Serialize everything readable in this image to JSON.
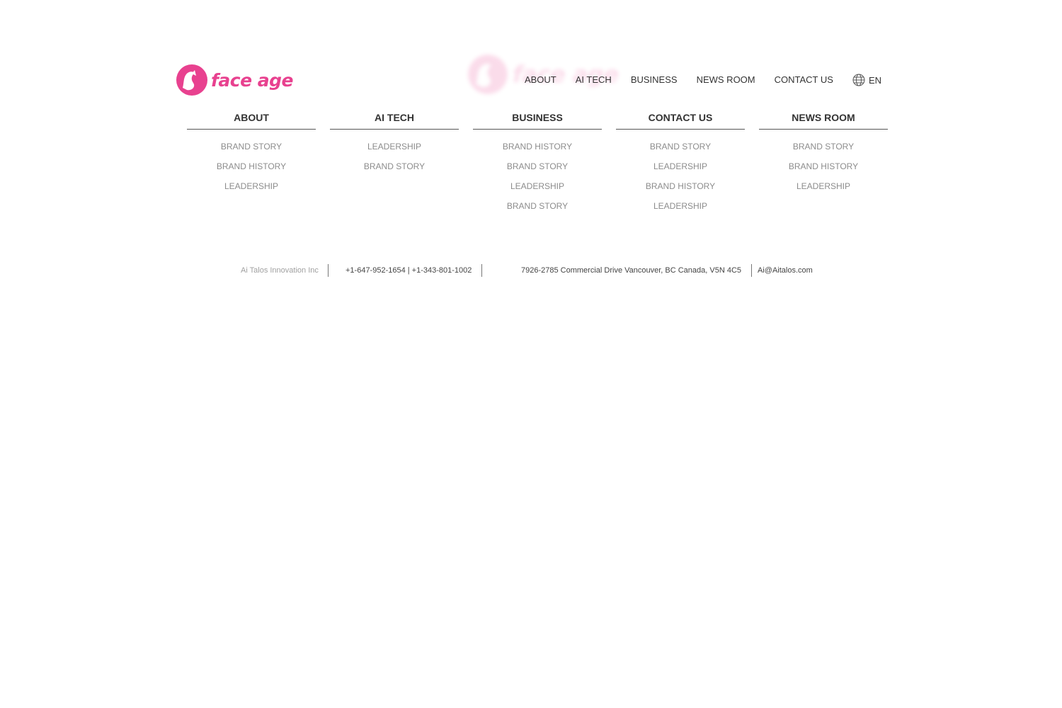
{
  "brand": {
    "logo_text": "face age",
    "accent_color": "#e8418f"
  },
  "topnav": {
    "items": [
      {
        "label": "ABOUT"
      },
      {
        "label": "AI TECH"
      },
      {
        "label": "BUSINESS"
      },
      {
        "label": "NEWS ROOM"
      },
      {
        "label": "CONTACT US"
      }
    ],
    "language": {
      "icon": "globe-icon",
      "label": "EN"
    }
  },
  "mega_menu": {
    "columns": [
      {
        "title": "ABOUT",
        "items": [
          "BRAND STORY",
          "BRAND HISTORY",
          "LEADERSHIP"
        ]
      },
      {
        "title": "AI TECH",
        "items": [
          "LEADERSHIP",
          "BRAND STORY"
        ]
      },
      {
        "title": "BUSINESS",
        "items": [
          "BRAND HISTORY",
          "BRAND STORY",
          "LEADERSHIP",
          "BRAND STORY"
        ]
      },
      {
        "title": "CONTACT US",
        "items": [
          "BRAND STORY",
          "LEADERSHIP",
          "BRAND HISTORY",
          "LEADERSHIP"
        ]
      },
      {
        "title": "NEWS ROOM",
        "items": [
          "BRAND STORY",
          "BRAND HISTORY",
          "LEADERSHIP"
        ]
      }
    ]
  },
  "footer": {
    "company": "Ai Talos Innovation Inc",
    "phones": "+1-647-952-1654 | +1-343-801-1002",
    "address": "7926-2785 Commercial Drive Vancouver, BC Canada, V5N 4C5",
    "email": "Ai@Aitalos.com"
  }
}
